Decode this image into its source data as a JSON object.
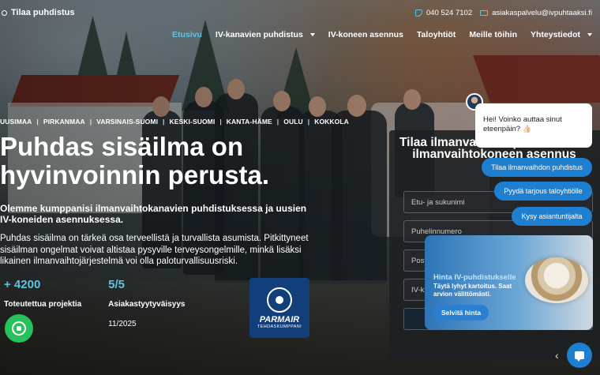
{
  "brand": {
    "name": "Tilaa puhdistus"
  },
  "contact": {
    "phone": "040 524 7102",
    "email": "asiakaspalvelu@ivpuhtaaksi.fi"
  },
  "nav": [
    {
      "label": "Etusivu",
      "active": true
    },
    {
      "label": "IV-kanavien puhdistus",
      "dropdown": true
    },
    {
      "label": "IV-koneen asennus"
    },
    {
      "label": "Taloyhtiöt"
    },
    {
      "label": "Meille töihin"
    },
    {
      "label": "Yhteystiedot",
      "dropdown": true
    }
  ],
  "regions": [
    "UUSIMAA",
    "PIRKANMAA",
    "VARSINAIS-SUOMI",
    "KESKI-SUOMI",
    "KANTA-HÄME",
    "OULU",
    "KOKKOLA"
  ],
  "hero": {
    "title": "Puhdas sisäilma on hyvinvoinnin perusta.",
    "subtitle": "Olemme kumppanisi ilmanvaihtokanavien puhdistuksessa ja uusien IV-koneiden asennuksessa.",
    "body": "Puhdas sisäilma on tärkeä osa terveellistä ja turvallista asumista. Pitkittyneet sisäilman ongelmat voivat altistaa pysyville terveysongelmille, minkä lisäksi likainen ilmanvaihtojärjestelmä voi olla paloturvallisuusriski."
  },
  "stats": [
    {
      "value": "+ 4200",
      "label": "Toteutettua projektia",
      "extra": ""
    },
    {
      "value": "5/5",
      "label": "Asiakastyytyväisyys",
      "extra": "11/2025"
    }
  ],
  "partner": {
    "brand": "PARMAIR",
    "sub": "TEHDASKUMPPANI"
  },
  "form": {
    "title": "Tilaa ilmanvaihdon puhdistus tai ilmanvaihtokoneen asennus",
    "fields": [
      {
        "placeholder": "Etu- ja sukunimi"
      },
      {
        "placeholder": "Puhelinnumero"
      },
      {
        "placeholder": "Post"
      },
      {
        "placeholder": "IV-k"
      }
    ]
  },
  "chat": {
    "greeting": "Hei! Voinko auttaa sinut eteenpäin? 👍🏻",
    "quick_replies": [
      "Tilaa ilmanvaihdon puhdistus",
      "Pyydä tarjous taloyhtiölle",
      "Kysy asiantuntijalta"
    ]
  },
  "promo": {
    "title": "Hinta IV-puhdistukselle",
    "text": "Täytä lyhyt kartoitus. Saat arvion välittömästi.",
    "button": "Selvitä hinta"
  },
  "colors": {
    "accent": "#5fc3e4",
    "chat_blue": "#1f7fd1",
    "whatsapp": "#29c15b",
    "parmair": "#123f7a"
  }
}
